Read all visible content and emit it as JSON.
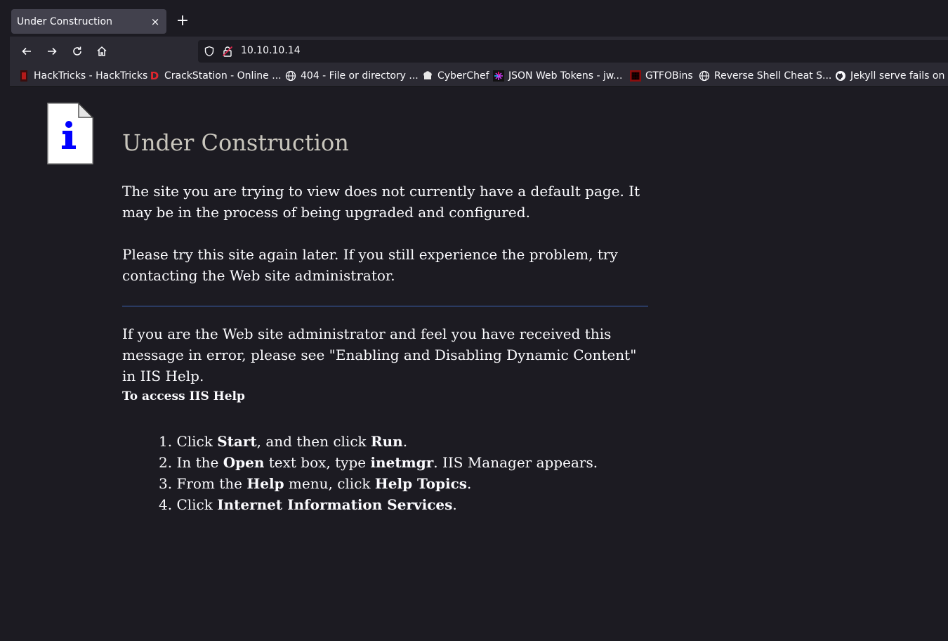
{
  "browser": {
    "tab": {
      "title": "Under Construction",
      "close": "×"
    },
    "new_tab": "+",
    "url": "10.10.10.14",
    "bookmarks": [
      {
        "label": "HackTricks - HackTricks",
        "icon": "hacktricks-icon"
      },
      {
        "label": "CrackStation - Online ...",
        "icon": "crackstation-icon"
      },
      {
        "label": "404 - File or directory ...",
        "icon": "globe-icon"
      },
      {
        "label": "CyberChef",
        "icon": "cyberchef-icon"
      },
      {
        "label": "JSON Web Tokens - jw...",
        "icon": "jwt-icon"
      },
      {
        "label": "GTFOBins",
        "icon": "gtfobins-icon"
      },
      {
        "label": "Reverse Shell Cheat S...",
        "icon": "globe-icon"
      },
      {
        "label": "Jekyll serve fails on Ru",
        "icon": "github-icon"
      }
    ]
  },
  "page": {
    "title": "Under Construction",
    "para1": "The site you are trying to view does not currently have a default page. It may be in the process of being upgraded and configured.",
    "para2": "Please try this site again later. If you still experience the problem, try contacting the Web site administrator.",
    "para3": "If you are the Web site administrator and feel you have received this message in error, please see \"Enabling and Disabling Dynamic Content\" in IIS Help.",
    "subhead": "To access IIS Help",
    "steps": [
      {
        "num": "1.",
        "parts": [
          "Click ",
          "Start",
          ", and then click ",
          "Run",
          "."
        ]
      },
      {
        "num": "2.",
        "parts": [
          "In the ",
          "Open",
          " text box, type ",
          "inetmgr",
          ". IIS Manager appears."
        ]
      },
      {
        "num": "3.",
        "parts": [
          "From the ",
          "Help",
          " menu, click ",
          "Help Topics",
          "."
        ]
      },
      {
        "num": "4.",
        "parts": [
          "Click ",
          "Internet Information Services",
          "."
        ]
      }
    ]
  },
  "colors": {
    "link_blue": "#0000ff",
    "title": "#c9c6bd",
    "rule": "#3e64b8"
  }
}
